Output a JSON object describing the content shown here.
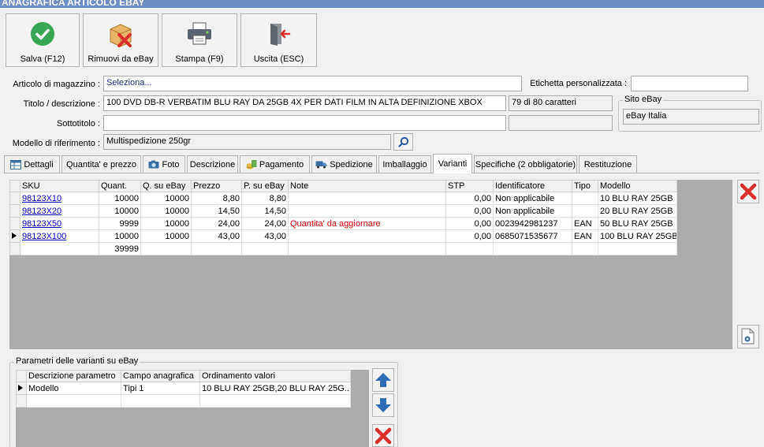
{
  "window": {
    "title": "ANAGRAFICA ARTICOLO EBAY"
  },
  "toolbar": {
    "save_label": "Salva (F12)",
    "remove_label": "Rimuovi da eBay",
    "print_label": "Stampa (F9)",
    "exit_label": "Uscita (ESC)"
  },
  "form": {
    "articolo_label": "Articolo di magazzino :",
    "articolo_value": "Seleziona...",
    "etichetta_label": "Etichetta personalizzata :",
    "etichetta_value": "",
    "titolo_label": "Titolo / descrizione :",
    "titolo_value": "100 DVD DB-R VERBATIM BLU RAY DA 25GB 4X PER DATI FILM IN ALTA DEFINIZIONE XBOX",
    "char_count": "79 di 80 caratteri",
    "sottotitolo_label": "Sottotitolo :",
    "sottotitolo_value": "",
    "modello_label": "Modello di riferimento :",
    "modello_value": "Multispedizione 250gr",
    "sito_label": "Sito eBay",
    "sito_value": "eBay Italia"
  },
  "tabs": [
    {
      "label": "Dettagli",
      "icon": "table-icon"
    },
    {
      "label": "Quantita' e prezzo",
      "icon": ""
    },
    {
      "label": "Foto",
      "icon": "camera-icon"
    },
    {
      "label": "Descrizione",
      "icon": ""
    },
    {
      "label": "Pagamento",
      "icon": "coins-icon"
    },
    {
      "label": "Spedizione",
      "icon": "truck-icon"
    },
    {
      "label": "Imballaggio",
      "icon": ""
    },
    {
      "label": "Varianti",
      "icon": ""
    },
    {
      "label": "Specifiche (2 obbligatorie)",
      "icon": ""
    },
    {
      "label": "Restituzione",
      "icon": ""
    }
  ],
  "active_tab": "Varianti",
  "variants": {
    "columns": [
      "SKU",
      "Quant.",
      "Q. su eBay",
      "Prezzo",
      "P. su eBay",
      "Note",
      "STP",
      "Identificatore",
      "Tipo",
      "Modello"
    ],
    "rows": [
      [
        "98123X10",
        "10000",
        "10000",
        "8,80",
        "8,80",
        "",
        "0,00",
        "Non applicabile",
        "",
        "10 BLU RAY 25GB"
      ],
      [
        "98123X20",
        "10000",
        "10000",
        "14,50",
        "14,50",
        "",
        "0,00",
        "Non applicabile",
        "",
        "20 BLU RAY 25GB"
      ],
      [
        "98123X50",
        "9999",
        "10000",
        "24,00",
        "24,00",
        "Quantita' da aggiornare",
        "0,00",
        "0023942981237",
        "EAN",
        "50 BLU RAY 25GB"
      ],
      [
        "98123X100",
        "10000",
        "10000",
        "43,00",
        "43,00",
        "",
        "0,00",
        "0685071535677",
        "EAN",
        "100 BLU RAY 25GB"
      ]
    ],
    "total_quantity": "39999"
  },
  "params": {
    "group_label": "Parametri delle varianti su eBay",
    "columns": [
      "Descrizione parametro",
      "Campo anagrafica",
      "Ordinamento valori"
    ],
    "rows": [
      [
        "Modello",
        "Tipi 1",
        "10 BLU RAY 25GB,20 BLU RAY 25G..."
      ]
    ]
  },
  "colors": {
    "titlebar": "#6b8fc4",
    "grid_bg": "#ababab",
    "link": "#0000cc",
    "warning": "#d10000",
    "save_green": "#3aa655",
    "delete_red": "#d9302c"
  }
}
